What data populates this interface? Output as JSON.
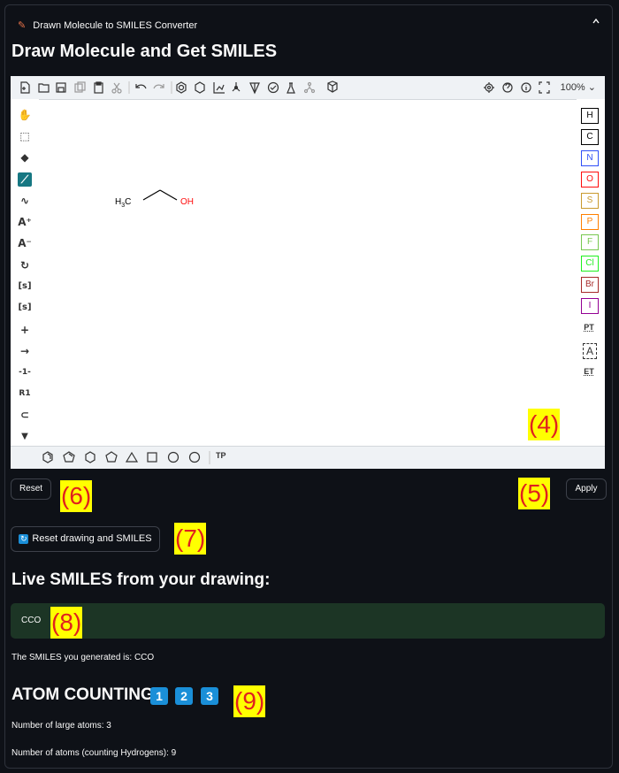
{
  "expander": {
    "title": "Drawn Molecule to SMILES Converter",
    "toggle_icon": "^"
  },
  "page_title": "Draw Molecule and Get SMILES",
  "editor": {
    "top_toolbar": {
      "icons": [
        "new-file-icon",
        "open-icon",
        "save-icon",
        "copy-icon",
        "paste-icon",
        "cut-icon",
        "undo-icon",
        "redo-icon",
        "aromatize-icon",
        "dearomatize-icon",
        "layout-icon",
        "clean-icon",
        "3d-view-icon",
        "check-icon",
        "calculate-icon",
        "stereo-icon",
        "cube-icon",
        "settings-icon",
        "help-icon",
        "info-icon",
        "fullscreen-icon"
      ],
      "zoom": "100%"
    },
    "left_toolbar": {
      "icons": [
        "hand-icon",
        "select-icon",
        "eraser-icon",
        "bond-icon",
        "chain-icon",
        "charge-plus-icon",
        "charge-minus-icon",
        "rotate-icon",
        "sgroup-icon",
        "sgroup-plus-icon",
        "plus-icon",
        "arrow-icon",
        "rgroup-label-icon",
        "rgroup-icon",
        "shape-icon",
        "more-icon"
      ],
      "labels": {
        "s1": "[s]",
        "s2": "[s]",
        "rg1": "-1-",
        "rg2": "R1"
      }
    },
    "right_toolbar": {
      "elements": [
        {
          "symbol": "H",
          "color": "#000000"
        },
        {
          "symbol": "C",
          "color": "#000000"
        },
        {
          "symbol": "N",
          "color": "#304ff7"
        },
        {
          "symbol": "O",
          "color": "#ff0d0d"
        },
        {
          "symbol": "S",
          "color": "#c99a2e"
        },
        {
          "symbol": "P",
          "color": "#ff8000"
        },
        {
          "symbol": "F",
          "color": "#78c850"
        },
        {
          "symbol": "Cl",
          "color": "#1ff01f"
        },
        {
          "symbol": "Br",
          "color": "#a62929"
        },
        {
          "symbol": "I",
          "color": "#940094"
        }
      ],
      "pt": "PT",
      "text_tool": "A",
      "et": "ET"
    },
    "bottom_toolbar": {
      "shapes": [
        "benzene-icon",
        "cyclopentadiene-icon",
        "cyclohexane-icon",
        "cyclopentane-icon",
        "cyclopropane-icon",
        "cyclobutane-icon",
        "cycloheptane-icon",
        "cyclooctane-icon"
      ],
      "tp": "TP"
    },
    "molecule": {
      "left_group": "H3C",
      "right_group": "OH",
      "oxygen_color": "#ff0d0d"
    }
  },
  "buttons": {
    "reset": "Reset",
    "apply": "Apply",
    "reset_drawing": "Reset drawing and SMILES"
  },
  "live_title": "Live SMILES from your drawing:",
  "smiles_value": "CCO",
  "generated_text": "The SMILES you generated is: CCO",
  "atom_counting": {
    "title": "ATOM COUNTING",
    "badges": [
      "1",
      "2",
      "3"
    ]
  },
  "stats": {
    "large_atoms": "Number of large atoms: 3",
    "all_atoms": "Number of atoms (counting Hydrogens): 9"
  },
  "annotations": {
    "a4": "(4)",
    "a5": "(5)",
    "a6": "(6)",
    "a7": "(7)",
    "a8": "(8)",
    "a9": "(9)"
  }
}
